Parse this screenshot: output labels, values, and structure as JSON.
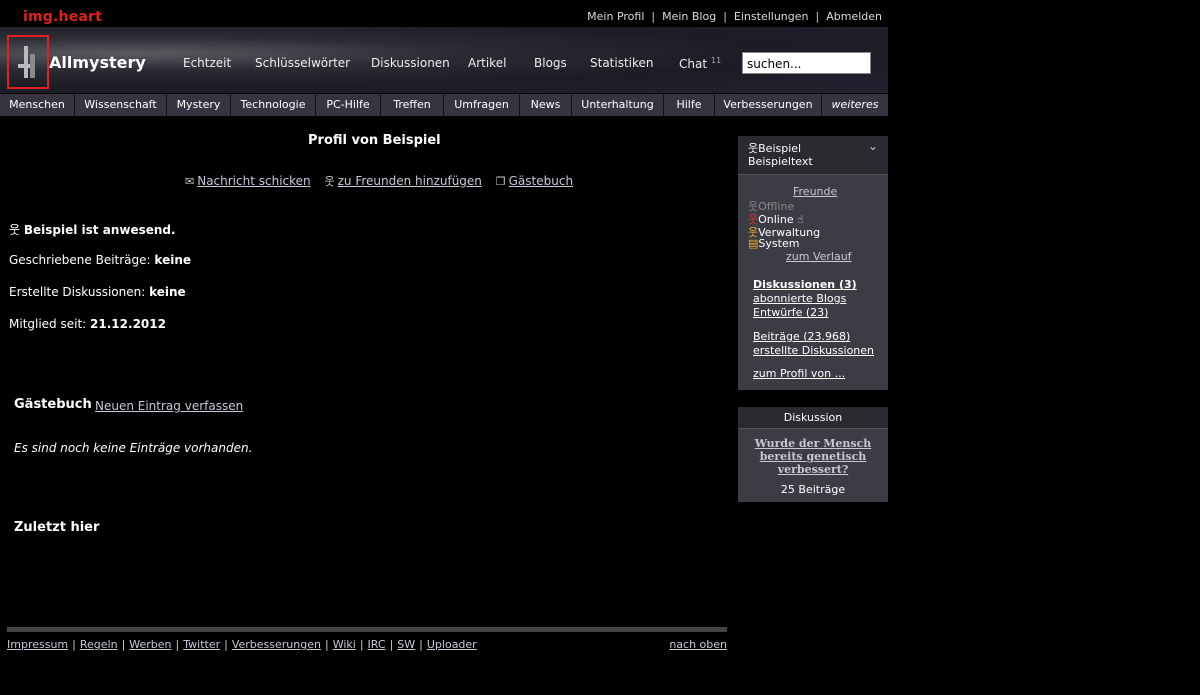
{
  "watermark": "img.heart",
  "top_links": [
    "Mein Profil",
    "Mein Blog",
    "Einstellungen",
    "Abmelden"
  ],
  "site": {
    "name": "Allmystery"
  },
  "main_nav": {
    "items": [
      "Echtzeit",
      "Schlüsselwörter",
      "Diskussionen",
      "Artikel",
      "Blogs",
      "Statistiken",
      "Chat"
    ],
    "chat_count": "11"
  },
  "search": {
    "placeholder": "suchen..."
  },
  "sub_nav": [
    "Menschen",
    "Wissenschaft",
    "Mystery",
    "Technologie",
    "PC-Hilfe",
    "Treffen",
    "Umfragen",
    "News",
    "Unterhaltung",
    "Hilfe",
    "Verbesserungen",
    "weiteres"
  ],
  "profile": {
    "title": "Profil von Beispiel",
    "actions": [
      "Nachricht schicken",
      "zu Freunden hinzufügen",
      "Gästebuch"
    ],
    "status": "Beispiel ist anwesend.",
    "posts_label": "Geschriebene Beiträge:",
    "posts_value": "keine",
    "discussions_label": "Erstellte Diskussionen:",
    "discussions_value": "keine",
    "member_label": "Mitglied seit:",
    "member_value": "21.12.2012"
  },
  "guestbook": {
    "title": "Gästebuch",
    "new_entry": "Neuen Eintrag verfassen",
    "empty": "Es sind noch keine Einträge vorhanden."
  },
  "last_here": {
    "title": "Zuletzt hier"
  },
  "footer": {
    "links": [
      "Impressum",
      "Regeln",
      "Werben",
      "Twitter",
      "Verbesserungen",
      "Wiki",
      "IRC",
      "SW",
      "Uploader"
    ],
    "top": "nach oben"
  },
  "sidebar_user": {
    "name": "Beispiel",
    "text": "Beispieltext",
    "friends": "Freunde",
    "offline": "Offline",
    "online": "Online",
    "admin": "Verwaltung",
    "system": "System",
    "history": "zum Verlauf",
    "discussions": "Diskussionen (3)",
    "subscribed_blogs": "abonnierte Blogs",
    "drafts": "Entwürfe (23)",
    "posts": "Beiträge (23.968)",
    "created_discussions": "erstellte Diskussionen",
    "profile_of": "zum Profil von ..."
  },
  "sidebar_discussion": {
    "title": "Diskussion",
    "question": "Wurde der Mensch bereits genetisch verbessert?",
    "count": "25 Beiträge"
  }
}
